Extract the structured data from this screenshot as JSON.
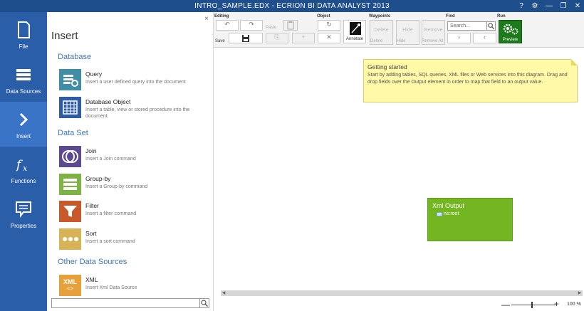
{
  "window": {
    "title": "INTRO_SAMPLE.EDX - ECRION BI DATA ANALYST 2013",
    "help": "?",
    "settings": "⚙",
    "minimize": "—",
    "restore": "❐",
    "close": "✕"
  },
  "nav": {
    "items": [
      {
        "label": "File",
        "icon": "document-icon"
      },
      {
        "label": "Data Sources",
        "icon": "database-icon"
      },
      {
        "label": "Insert",
        "icon": "chevron-right-icon",
        "active": true
      },
      {
        "label": "Functions",
        "icon": "function-icon"
      },
      {
        "label": "Properties",
        "icon": "properties-icon"
      }
    ]
  },
  "panel": {
    "title": "Insert",
    "close": "×",
    "sections": [
      {
        "title": "Database",
        "items": [
          {
            "name": "Query",
            "desc": "Insert a user defined query into the document",
            "icon": "query-icon",
            "color": "#3f8ea8"
          },
          {
            "name": "Database Object",
            "desc": "Insert a table, view or stored procedure into the document.",
            "icon": "table-icon",
            "color": "#2e5ea1"
          }
        ]
      },
      {
        "title": "Data Set",
        "items": [
          {
            "name": "Join",
            "desc": "Insert a Join command",
            "icon": "join-icon",
            "color": "#5b4a93"
          },
          {
            "name": "Group-by",
            "desc": "Insert a Group-by command",
            "icon": "groupby-icon",
            "color": "#7cb342"
          },
          {
            "name": "Filter",
            "desc": "Insert a filter command",
            "icon": "filter-icon",
            "color": "#c9592b"
          },
          {
            "name": "Sort",
            "desc": "Insert a sort command",
            "icon": "sort-icon",
            "color": "#d9b256"
          }
        ]
      },
      {
        "title": "Other Data Sources",
        "items": [
          {
            "name": "XML",
            "desc": "Insert Xml Data Source",
            "icon": "xml-icon",
            "color": "#e8a13a",
            "glyph": "XML"
          }
        ]
      }
    ],
    "search": {
      "value": ""
    }
  },
  "ribbon": {
    "groups": {
      "editing": "Editing",
      "object": "Object",
      "waypoints": "Waypoints",
      "find": "Find",
      "run": "Run"
    },
    "editing": {
      "undo": "↶",
      "redo": "↷",
      "paste_label": "Paste",
      "save_label": "Save",
      "cut": "✂",
      "copy": "⎘",
      "add": "+",
      "delete": "✕",
      "refresh": "↻"
    },
    "annotate_label": "Annotate",
    "waypoints": {
      "delete_top": "Delete",
      "hide_top": "Hide",
      "remove_top": "Remove",
      "delete_bottom": "Delete",
      "hide_bottom": "Hide",
      "remove_all": "Remove All"
    },
    "find": {
      "placeholder": "Search...",
      "next": "›",
      "prev": "‹"
    },
    "preview_label": "Preview"
  },
  "canvas": {
    "note": {
      "title": "Getting started",
      "text": "Start by adding tables, SQL queries, XML files or Web services into this diagram. Drag and drop fields over the Output element in order to map that field to an output value."
    },
    "output": {
      "title": "Xml Output",
      "node": "ns:root"
    }
  },
  "status": {
    "zoom_minus": "—",
    "zoom_plus": "+",
    "zoom": "100 %",
    "zoom_level": 100
  }
}
